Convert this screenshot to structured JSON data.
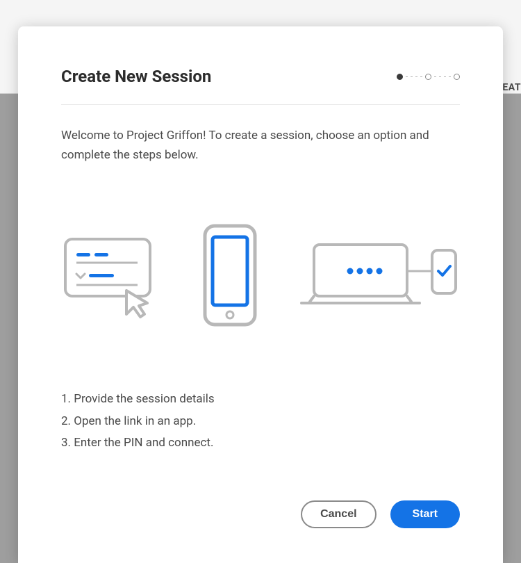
{
  "background": {
    "partial_label": "EAT"
  },
  "modal": {
    "title": "Create New Session",
    "intro": "Welcome to Project Griffon! To create a session, choose an option and complete the steps below.",
    "stepper": {
      "current": 1,
      "total": 3
    },
    "steps": {
      "step1": "1. Provide the session details",
      "step2": "2. Open the link in an app.",
      "step3": "3. Enter the PIN and connect."
    },
    "buttons": {
      "cancel": "Cancel",
      "start": "Start"
    },
    "colors": {
      "primary": "#1473e6",
      "illustration_stroke": "#b8b8b8",
      "illustration_accent": "#1473e6"
    }
  }
}
